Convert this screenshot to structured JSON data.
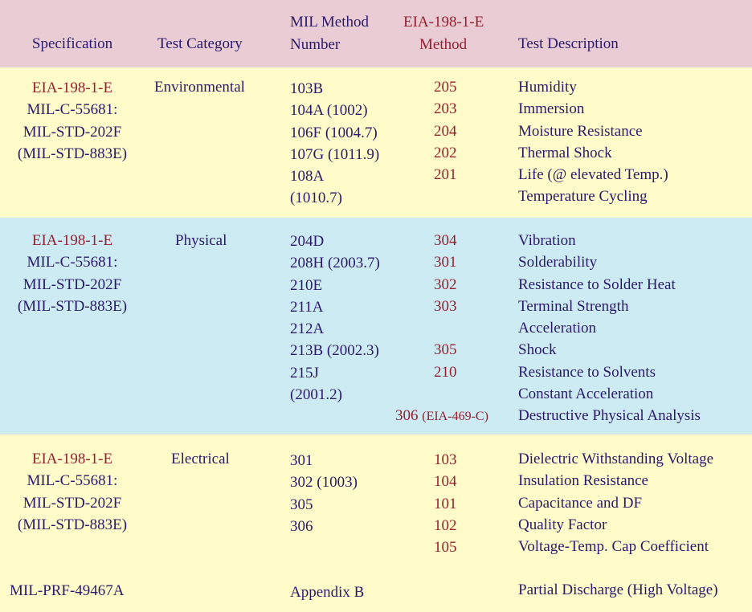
{
  "header": {
    "specification": "Specification",
    "test_category": "Test Category",
    "mil_method_line1": "MIL Method",
    "mil_method_line2": "Number",
    "eia_method_line1": "EIA-198-1-E",
    "eia_method_line2": "Method",
    "test_description": "Test Description"
  },
  "colors": {
    "header_bg": "#EACDD4",
    "yellow_bg": "#FFFCC9",
    "blue_bg": "#CCEBF3",
    "text_navy": "#2B1A6B",
    "text_red": "#962030"
  },
  "sections": [
    {
      "spec": [
        "EIA-198-1-E",
        "MIL-C-55681:",
        "MIL-STD-202F",
        "(MIL-STD-883E)"
      ],
      "category": "Environmental",
      "mil_methods": [
        "103B",
        "104A (1002)",
        "106F (1004.7)",
        "107G (1011.9)",
        "108A",
        "(1010.7)"
      ],
      "eia_methods": [
        "205",
        "203",
        "204",
        "202",
        "201",
        ""
      ],
      "descriptions": [
        "Humidity",
        "Immersion",
        "Moisture Resistance",
        "Thermal Shock",
        "Life (@ elevated Temp.)",
        "Temperature Cycling"
      ]
    },
    {
      "spec": [
        "EIA-198-1-E",
        "MIL-C-55681:",
        "MIL-STD-202F",
        "(MIL-STD-883E)"
      ],
      "category": "Physical",
      "mil_methods": [
        "204D",
        "208H (2003.7)",
        "210E",
        "211A",
        "212A",
        "213B (2002.3)",
        "215J",
        "(2001.2)",
        ""
      ],
      "eia_methods": [
        "304",
        "301",
        "302",
        "303",
        "",
        "305",
        "210",
        "",
        ""
      ],
      "eia_extra": {
        "number": "306",
        "note": "(EIA-469-C)"
      },
      "descriptions": [
        "Vibration",
        "Solderability",
        "Resistance to Solder Heat",
        "Terminal Strength",
        "Acceleration",
        "Shock",
        "Resistance to Solvents",
        "Constant Acceleration",
        "Destructive Physical Analysis"
      ]
    },
    {
      "spec": [
        "EIA-198-1-E",
        "MIL-C-55681:",
        "MIL-STD-202F",
        "(MIL-STD-883E)"
      ],
      "category": "Electrical",
      "mil_methods": [
        "301",
        "302 (1003)",
        "305",
        "306",
        ""
      ],
      "eia_methods": [
        "103",
        "104",
        "101",
        "102",
        "105"
      ],
      "descriptions": [
        "Dielectric Withstanding Voltage",
        "Insulation Resistance",
        "Capacitance and DF",
        "Quality Factor",
        "Voltage-Temp. Cap Coefficient"
      ]
    }
  ],
  "footer_row": {
    "spec": "MIL-PRF-49467A",
    "mil_method": "Appendix B",
    "description": "Partial Discharge (High Voltage)"
  }
}
